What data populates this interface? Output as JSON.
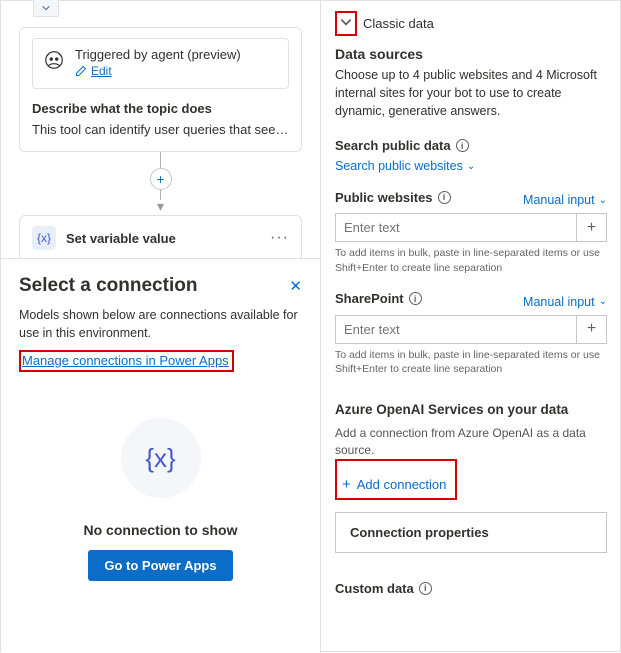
{
  "left": {
    "trigger": {
      "title": "Triggered by agent (preview)",
      "edit": "Edit",
      "describe_label": "Describe what the topic does",
      "describe_text": "This tool can identify user queries that seek f..."
    },
    "variable_node": {
      "icon_text": "{x}",
      "title": "Set variable value",
      "menu": "···"
    },
    "connection": {
      "title": "Select a connection",
      "desc": "Models shown below are connections available for use in this environment.",
      "manage_link": "Manage connections in Power Apps",
      "empty_icon": "{x}",
      "empty_title": "No connection to show",
      "go_button": "Go to Power Apps"
    }
  },
  "right": {
    "classic": "Classic data",
    "data_sources": {
      "title": "Data sources",
      "desc": "Choose up to 4 public websites and 4 Microsoft internal sites for your bot to use to create dynamic, generative answers."
    },
    "search": {
      "label": "Search public data",
      "link": "Search public websites"
    },
    "public": {
      "label": "Public websites",
      "mode": "Manual input",
      "placeholder": "Enter text",
      "hint": "To add items in bulk, paste in line-separated items or use Shift+Enter to create line separation"
    },
    "sharepoint": {
      "label": "SharePoint",
      "mode": "Manual input",
      "placeholder": "Enter text",
      "hint": "To add items in bulk, paste in line-separated items or use Shift+Enter to create line separation"
    },
    "azure": {
      "title": "Azure OpenAI Services on your data",
      "desc": "Add a connection from Azure OpenAI as a data source.",
      "add_connection": "Add connection",
      "conn_props": "Connection properties"
    },
    "custom": {
      "label": "Custom data"
    }
  }
}
